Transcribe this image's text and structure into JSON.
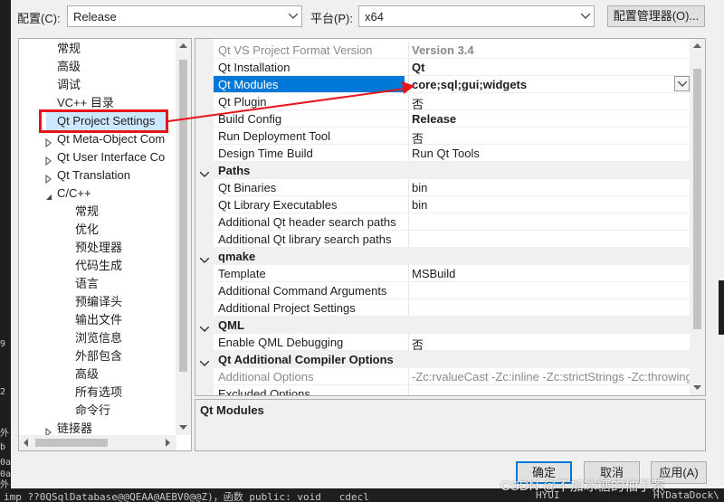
{
  "toolbar": {
    "config_label": "配置(C):",
    "config_value": "Release",
    "platform_label": "平台(P):",
    "platform_value": "x64",
    "config_manager_label": "配置管理器(O)..."
  },
  "tree": {
    "items": [
      {
        "label": "常规",
        "level": 1,
        "expander": "none"
      },
      {
        "label": "高级",
        "level": 1,
        "expander": "none"
      },
      {
        "label": "调试",
        "level": 1,
        "expander": "none"
      },
      {
        "label": "VC++ 目录",
        "level": 1,
        "expander": "none"
      },
      {
        "label": "Qt Project Settings",
        "level": 1,
        "expander": "none",
        "selected": true
      },
      {
        "label": "Qt Meta-Object Com",
        "level": 1,
        "expander": "collapsed"
      },
      {
        "label": "Qt User Interface Co",
        "level": 1,
        "expander": "collapsed"
      },
      {
        "label": "Qt Translation",
        "level": 1,
        "expander": "collapsed"
      },
      {
        "label": "C/C++",
        "level": 1,
        "expander": "expanded"
      },
      {
        "label": "常规",
        "level": 2,
        "expander": "none"
      },
      {
        "label": "优化",
        "level": 2,
        "expander": "none"
      },
      {
        "label": "预处理器",
        "level": 2,
        "expander": "none"
      },
      {
        "label": "代码生成",
        "level": 2,
        "expander": "none"
      },
      {
        "label": "语言",
        "level": 2,
        "expander": "none"
      },
      {
        "label": "预编译头",
        "level": 2,
        "expander": "none"
      },
      {
        "label": "输出文件",
        "level": 2,
        "expander": "none"
      },
      {
        "label": "浏览信息",
        "level": 2,
        "expander": "none"
      },
      {
        "label": "外部包含",
        "level": 2,
        "expander": "none"
      },
      {
        "label": "高级",
        "level": 2,
        "expander": "none"
      },
      {
        "label": "所有选项",
        "level": 2,
        "expander": "none"
      },
      {
        "label": "命令行",
        "level": 2,
        "expander": "none"
      },
      {
        "label": "链接器",
        "level": 1,
        "expander": "collapsed"
      }
    ]
  },
  "grid": {
    "rows": [
      {
        "type": "prop",
        "name": "Qt VS Project Format Version",
        "value": "Version 3.4",
        "style": "gray-bold"
      },
      {
        "type": "prop",
        "name": "Qt Installation",
        "value": "Qt",
        "style": "bold"
      },
      {
        "type": "prop",
        "name": "Qt Modules",
        "value": "core;sql;gui;widgets",
        "style": "selected"
      },
      {
        "type": "prop",
        "name": "Qt Plugin",
        "value": "否",
        "style": ""
      },
      {
        "type": "prop",
        "name": "Build Config",
        "value": "Release",
        "style": "bold"
      },
      {
        "type": "prop",
        "name": "Run Deployment Tool",
        "value": "否",
        "style": ""
      },
      {
        "type": "prop",
        "name": "Design Time Build",
        "value": "Run Qt Tools",
        "style": ""
      },
      {
        "type": "cat",
        "name": "Paths"
      },
      {
        "type": "prop",
        "name": "Qt Binaries",
        "value": "bin",
        "style": ""
      },
      {
        "type": "prop",
        "name": "Qt Library Executables",
        "value": "bin",
        "style": ""
      },
      {
        "type": "prop",
        "name": "Additional Qt header search paths",
        "value": "",
        "style": ""
      },
      {
        "type": "prop",
        "name": "Additional Qt library search paths",
        "value": "",
        "style": ""
      },
      {
        "type": "cat",
        "name": "qmake"
      },
      {
        "type": "prop",
        "name": "Template",
        "value": "MSBuild",
        "style": ""
      },
      {
        "type": "prop",
        "name": "Additional Command Arguments",
        "value": "",
        "style": ""
      },
      {
        "type": "prop",
        "name": "Additional Project Settings",
        "value": "",
        "style": ""
      },
      {
        "type": "cat",
        "name": "QML"
      },
      {
        "type": "prop",
        "name": "Enable QML Debugging",
        "value": "否",
        "style": ""
      },
      {
        "type": "cat",
        "name": "Qt Additional Compiler Options"
      },
      {
        "type": "prop",
        "name": "Additional Options",
        "value": "-Zc:rvalueCast -Zc:inline -Zc:strictStrings -Zc:throwingN",
        "style": "gray"
      },
      {
        "type": "prop",
        "name": "Excluded Options",
        "value": "",
        "style": ""
      }
    ]
  },
  "description": {
    "title": "Qt Modules"
  },
  "buttons": {
    "ok": "确定",
    "cancel": "取消",
    "apply": "应用(A)"
  },
  "watermark": "CSDN @不加冰糖的柚子茶",
  "background": {
    "bottom_line": "imp_??0QSqlDatabase@@QEAA@AEBV0@@Z)，函数 public: void __cdecl",
    "bottom_right_1": "HYUI",
    "bottom_right_2": "HYDataDock\\",
    "left_glyphs": [
      "9",
      "2",
      "外",
      "b",
      "0a",
      "0a",
      "外"
    ]
  },
  "colors": {
    "selection": "#0078d7",
    "tree_selection": "#cce8ff",
    "annotation": "#e8141c"
  }
}
